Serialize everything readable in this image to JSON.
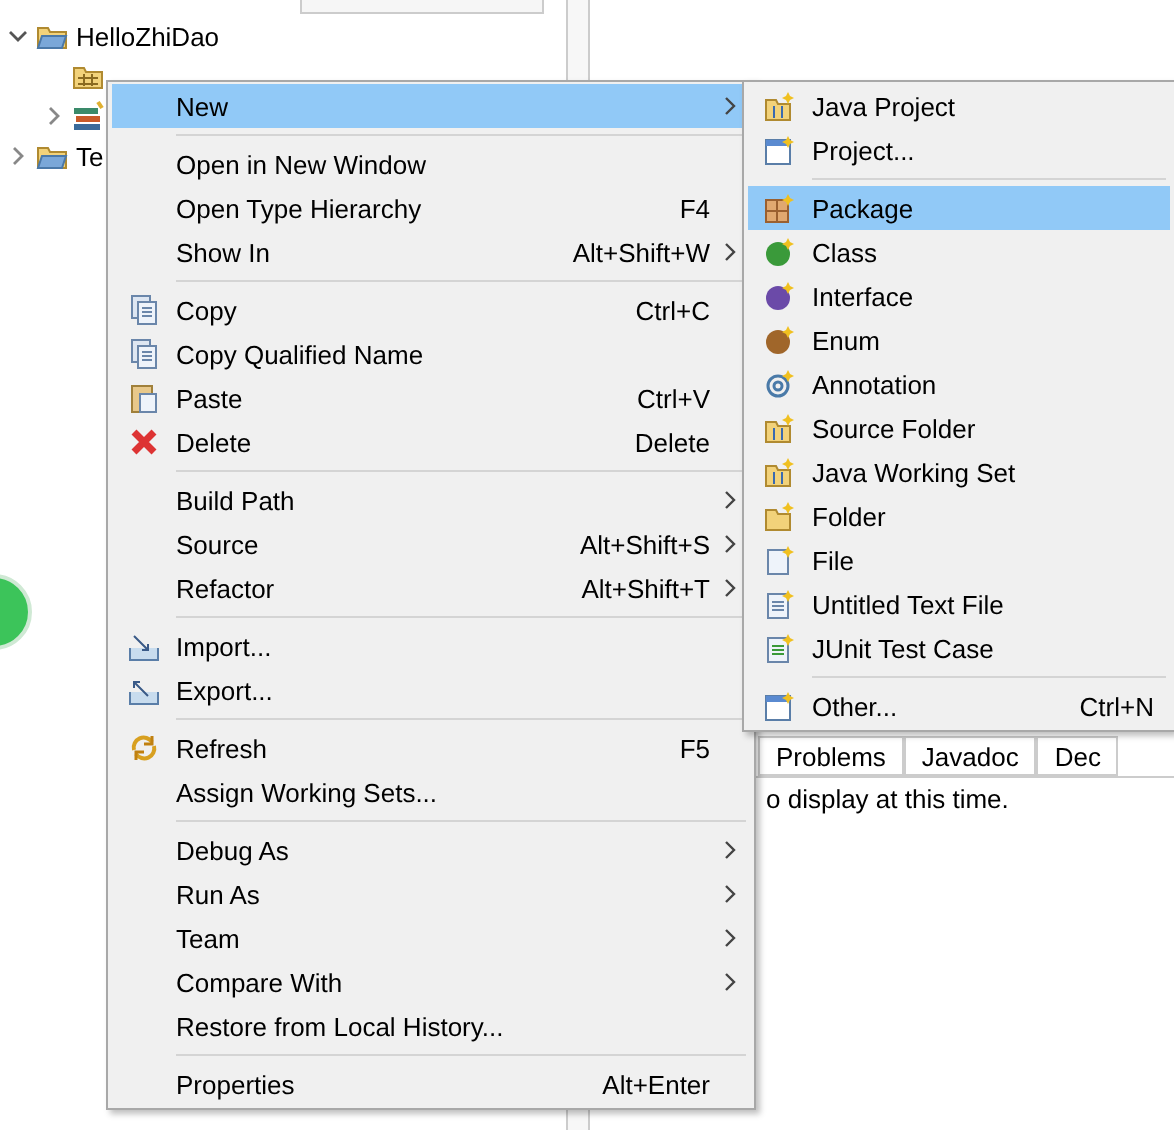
{
  "tree": [
    {
      "label": "HelloZhiDao",
      "expanded": true,
      "children": [
        {
          "kind": "package"
        },
        {
          "kind": "library",
          "expanded": false
        }
      ]
    },
    {
      "label": "Te",
      "expanded": false
    }
  ],
  "bottom_panel": {
    "tabs": [
      {
        "label": "Problems",
        "selected": false
      },
      {
        "label": "Javadoc",
        "selected": false
      },
      {
        "label": "Dec",
        "selected": false
      }
    ],
    "message": "o display at this time."
  },
  "context_menu": {
    "groups": [
      [
        {
          "label": "New",
          "submenu": true,
          "selected": true
        }
      ],
      [
        {
          "label": "Open in New Window",
          "submenu": false,
          "selected": false
        },
        {
          "label": "Open Type Hierarchy",
          "shortcut": "F4",
          "submenu": false,
          "selected": false
        },
        {
          "label": "Show In",
          "shortcut": "Alt+Shift+W",
          "submenu": true,
          "selected": false
        }
      ],
      [
        {
          "label": "Copy",
          "shortcut": "Ctrl+C",
          "submenu": false,
          "selected": false
        },
        {
          "label": "Copy Qualified Name",
          "submenu": false,
          "selected": false
        },
        {
          "label": "Paste",
          "shortcut": "Ctrl+V",
          "submenu": false,
          "selected": false
        },
        {
          "label": "Delete",
          "shortcut": "Delete",
          "submenu": false,
          "selected": false
        }
      ],
      [
        {
          "label": "Build Path",
          "submenu": true,
          "selected": false
        },
        {
          "label": "Source",
          "shortcut": "Alt+Shift+S",
          "submenu": true,
          "selected": false
        },
        {
          "label": "Refactor",
          "shortcut": "Alt+Shift+T",
          "submenu": true,
          "selected": false
        }
      ],
      [
        {
          "label": "Import...",
          "submenu": false,
          "selected": false
        },
        {
          "label": "Export...",
          "submenu": false,
          "selected": false
        }
      ],
      [
        {
          "label": "Refresh",
          "shortcut": "F5",
          "submenu": false,
          "selected": false
        },
        {
          "label": "Assign Working Sets...",
          "submenu": false,
          "selected": false
        }
      ],
      [
        {
          "label": "Debug As",
          "submenu": true,
          "selected": false
        },
        {
          "label": "Run As",
          "submenu": true,
          "selected": false
        },
        {
          "label": "Team",
          "submenu": true,
          "selected": false
        },
        {
          "label": "Compare With",
          "submenu": true,
          "selected": false
        },
        {
          "label": "Restore from Local History...",
          "submenu": false,
          "selected": false
        }
      ],
      [
        {
          "label": "Properties",
          "shortcut": "Alt+Enter",
          "submenu": false,
          "selected": false
        }
      ]
    ]
  },
  "new_submenu": {
    "groups": [
      [
        {
          "label": "Java Project",
          "selected": false
        },
        {
          "label": "Project...",
          "selected": false
        }
      ],
      [
        {
          "label": "Package",
          "selected": true
        },
        {
          "label": "Class",
          "selected": false
        },
        {
          "label": "Interface",
          "selected": false
        },
        {
          "label": "Enum",
          "selected": false
        },
        {
          "label": "Annotation",
          "selected": false
        },
        {
          "label": "Source Folder",
          "selected": false
        },
        {
          "label": "Java Working Set",
          "selected": false
        },
        {
          "label": "Folder",
          "selected": false
        },
        {
          "label": "File",
          "selected": false
        },
        {
          "label": "Untitled Text File",
          "selected": false
        },
        {
          "label": "JUnit Test Case",
          "selected": false
        }
      ],
      [
        {
          "label": "Other...",
          "shortcut": "Ctrl+N",
          "selected": false
        }
      ]
    ]
  }
}
